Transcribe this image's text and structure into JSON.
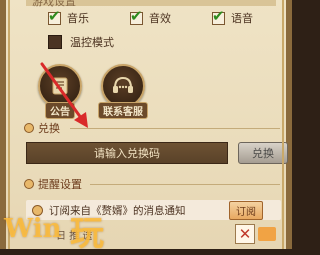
{
  "header": {
    "title_remnant": "游戏设置"
  },
  "sound_settings": {
    "music": {
      "label": "音乐",
      "checked": true
    },
    "sfx": {
      "label": "音效",
      "checked": true
    },
    "voice": {
      "label": "语音",
      "checked": true
    },
    "temp_mode": {
      "label": "温控模式",
      "checked": false
    }
  },
  "icons": {
    "announcement": {
      "label": "公告",
      "icon": "scroll-icon"
    },
    "customer_service": {
      "label": "联系客服",
      "icon": "headset-icon"
    }
  },
  "redeem": {
    "section_title": "兑换",
    "placeholder": "请输入兑换码",
    "button_label": "兑换"
  },
  "reminder": {
    "section_title": "提醒设置",
    "subscribe_text": "订阅来自《赘婿》的消息通知",
    "subscribe_button": "订阅",
    "bottom_text": "日 推 送",
    "close_icon": "close-icon"
  },
  "watermark": {
    "left": "Win",
    "right": "玩"
  },
  "colors": {
    "accent": "#e8a861",
    "panel_bg": "#efe3c5",
    "input_bg": "#5a4229",
    "check": "#2e8b1e",
    "annotation_arrow": "#d92a2a"
  }
}
